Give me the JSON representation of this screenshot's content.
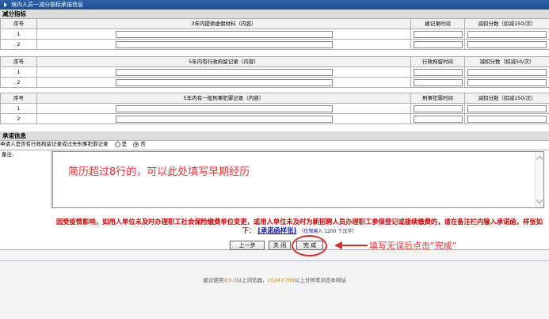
{
  "title_bar": "境内人员一减分指标承诺信息",
  "section_reduce": "减分指标",
  "section_promise": "承诺信息",
  "table1": {
    "col_no": "序号",
    "col_content": "3年内提供虚假材料（内容）",
    "col_time": "被记录时间",
    "col_score": "减扣分数（扣减150/次）",
    "rows": [
      "1",
      "2"
    ]
  },
  "table2": {
    "col_no": "序号",
    "col_content": "5年内有行政拘留记录（内容）",
    "col_time": "行政拘留时间",
    "col_score": "减扣分数（扣减50/次）",
    "rows": [
      "1",
      "2"
    ]
  },
  "table3": {
    "col_no": "序号",
    "col_content": "5年内有一般刑事犯罪记录（内容）",
    "col_time": "刑事犯罪时间",
    "col_score": "减扣分数（扣减150/次）",
    "rows": [
      "1",
      "2"
    ]
  },
  "promise_question": "申请人是否有行政拘留记录或过失刑事犯罪记录",
  "option_yes": "是",
  "option_no": "否",
  "selected_option": "否",
  "remark_label": "备注:",
  "annotation_remark": "简历超过8行的，可以此处填写早期经历",
  "notice_line1": "因受疫情影响，如用人单位未及时办理职工社会保险缴费单位变更，或用人单位未及时为新招聘人员办理职工参保登记或接续缴费的，请在备注栏内输入承诺函，样张如下：",
  "notice_link": "[承诺函样张]",
  "notice_limit": "（仅限输入 1200 个汉字）",
  "buttons": {
    "prev": "上一步",
    "close": "关 闭",
    "done": "完 成"
  },
  "annotation_done": "填写无误后点击“完成”",
  "footer": {
    "prefix": "建议使用",
    "ie": "IE9.0",
    "middle": "以上浏览器，",
    "resolution": "1024×768",
    "suffix": "以上分辨率浏览本网站"
  },
  "colors": {
    "title_bar": "#1d4c91",
    "annotation": "#e8322f",
    "notice": "#d40000",
    "link": "#1a1aa8"
  }
}
